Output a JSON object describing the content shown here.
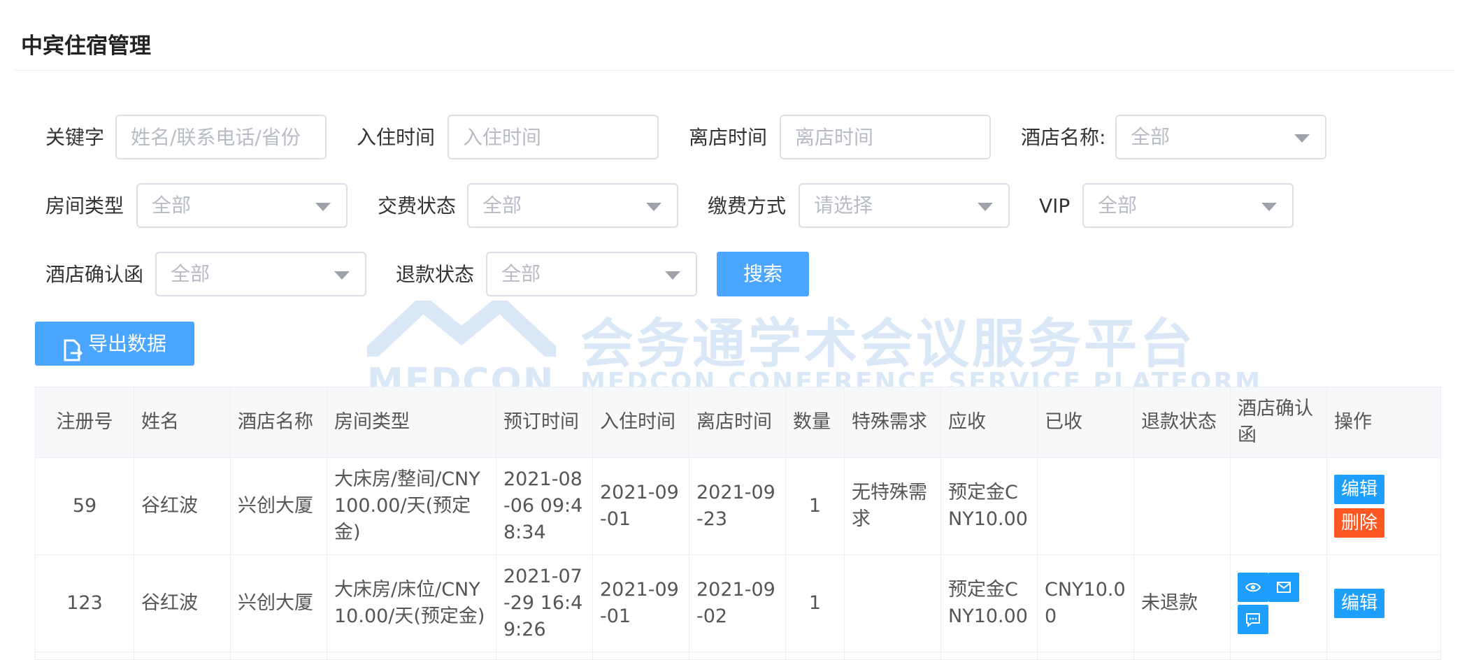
{
  "page": {
    "title": "中宾住宿管理"
  },
  "filters": {
    "keyword": {
      "label": "关键字",
      "placeholder": "姓名/联系电话/省份"
    },
    "checkin": {
      "label": "入住时间",
      "placeholder": "入住时间"
    },
    "checkout": {
      "label": "离店时间",
      "placeholder": "离店时间"
    },
    "hotel": {
      "label": "酒店名称:",
      "value": "全部"
    },
    "room_type": {
      "label": "房间类型",
      "value": "全部"
    },
    "pay_status": {
      "label": "交费状态",
      "value": "全部"
    },
    "pay_method": {
      "label": "缴费方式",
      "value": "请选择"
    },
    "vip": {
      "label": "VIP",
      "value": "全部"
    },
    "confirm_letter": {
      "label": "酒店确认函",
      "value": "全部"
    },
    "refund_status": {
      "label": "退款状态",
      "value": "全部"
    }
  },
  "actions": {
    "search": "搜索",
    "export": "导出数据"
  },
  "watermark": {
    "cn": "会务通学术会议服务平台",
    "logo": "MEDCON",
    "en": "MEDCON CONFERENCE SERVICE PLATFORM"
  },
  "table": {
    "columns": [
      "注册号",
      "姓名",
      "酒店名称",
      "房间类型",
      "预订时间",
      "入住时间",
      "离店时间",
      "数量",
      "特殊需求",
      "应收",
      "已收",
      "退款状态",
      "酒店确认函",
      "操作"
    ],
    "rows": [
      {
        "id": "59",
        "name": "谷红波",
        "hotel": "兴创大厦",
        "room": "大床房/整间/CNY100.00/天(预定金)",
        "booked": "2021-08-06 09:48:34",
        "checkin": "2021-09-01",
        "checkout": "2021-09-23",
        "qty": "1",
        "special": "无特殊需求",
        "receivable": "预定金CNY10.00",
        "received": "",
        "refund": "",
        "edit": "编辑",
        "delete": "删除"
      },
      {
        "id": "123",
        "name": "谷红波",
        "hotel": "兴创大厦",
        "room": "大床房/床位/CNY10.00/天(预定金)",
        "booked": "2021-07-29 16:49:26",
        "checkin": "2021-09-01",
        "checkout": "2021-09-02",
        "qty": "1",
        "special": "",
        "receivable": "预定金CNY10.00",
        "received": "CNY10.00",
        "refund": "未退款",
        "edit": "编辑"
      }
    ]
  },
  "colors": {
    "primary": "#4aa6ff",
    "edit": "#1e9fff",
    "delete": "#ff5722"
  },
  "icons": [
    "file-export-icon",
    "eye-icon",
    "mail-icon",
    "message-icon",
    "chevron-down-icon"
  ]
}
